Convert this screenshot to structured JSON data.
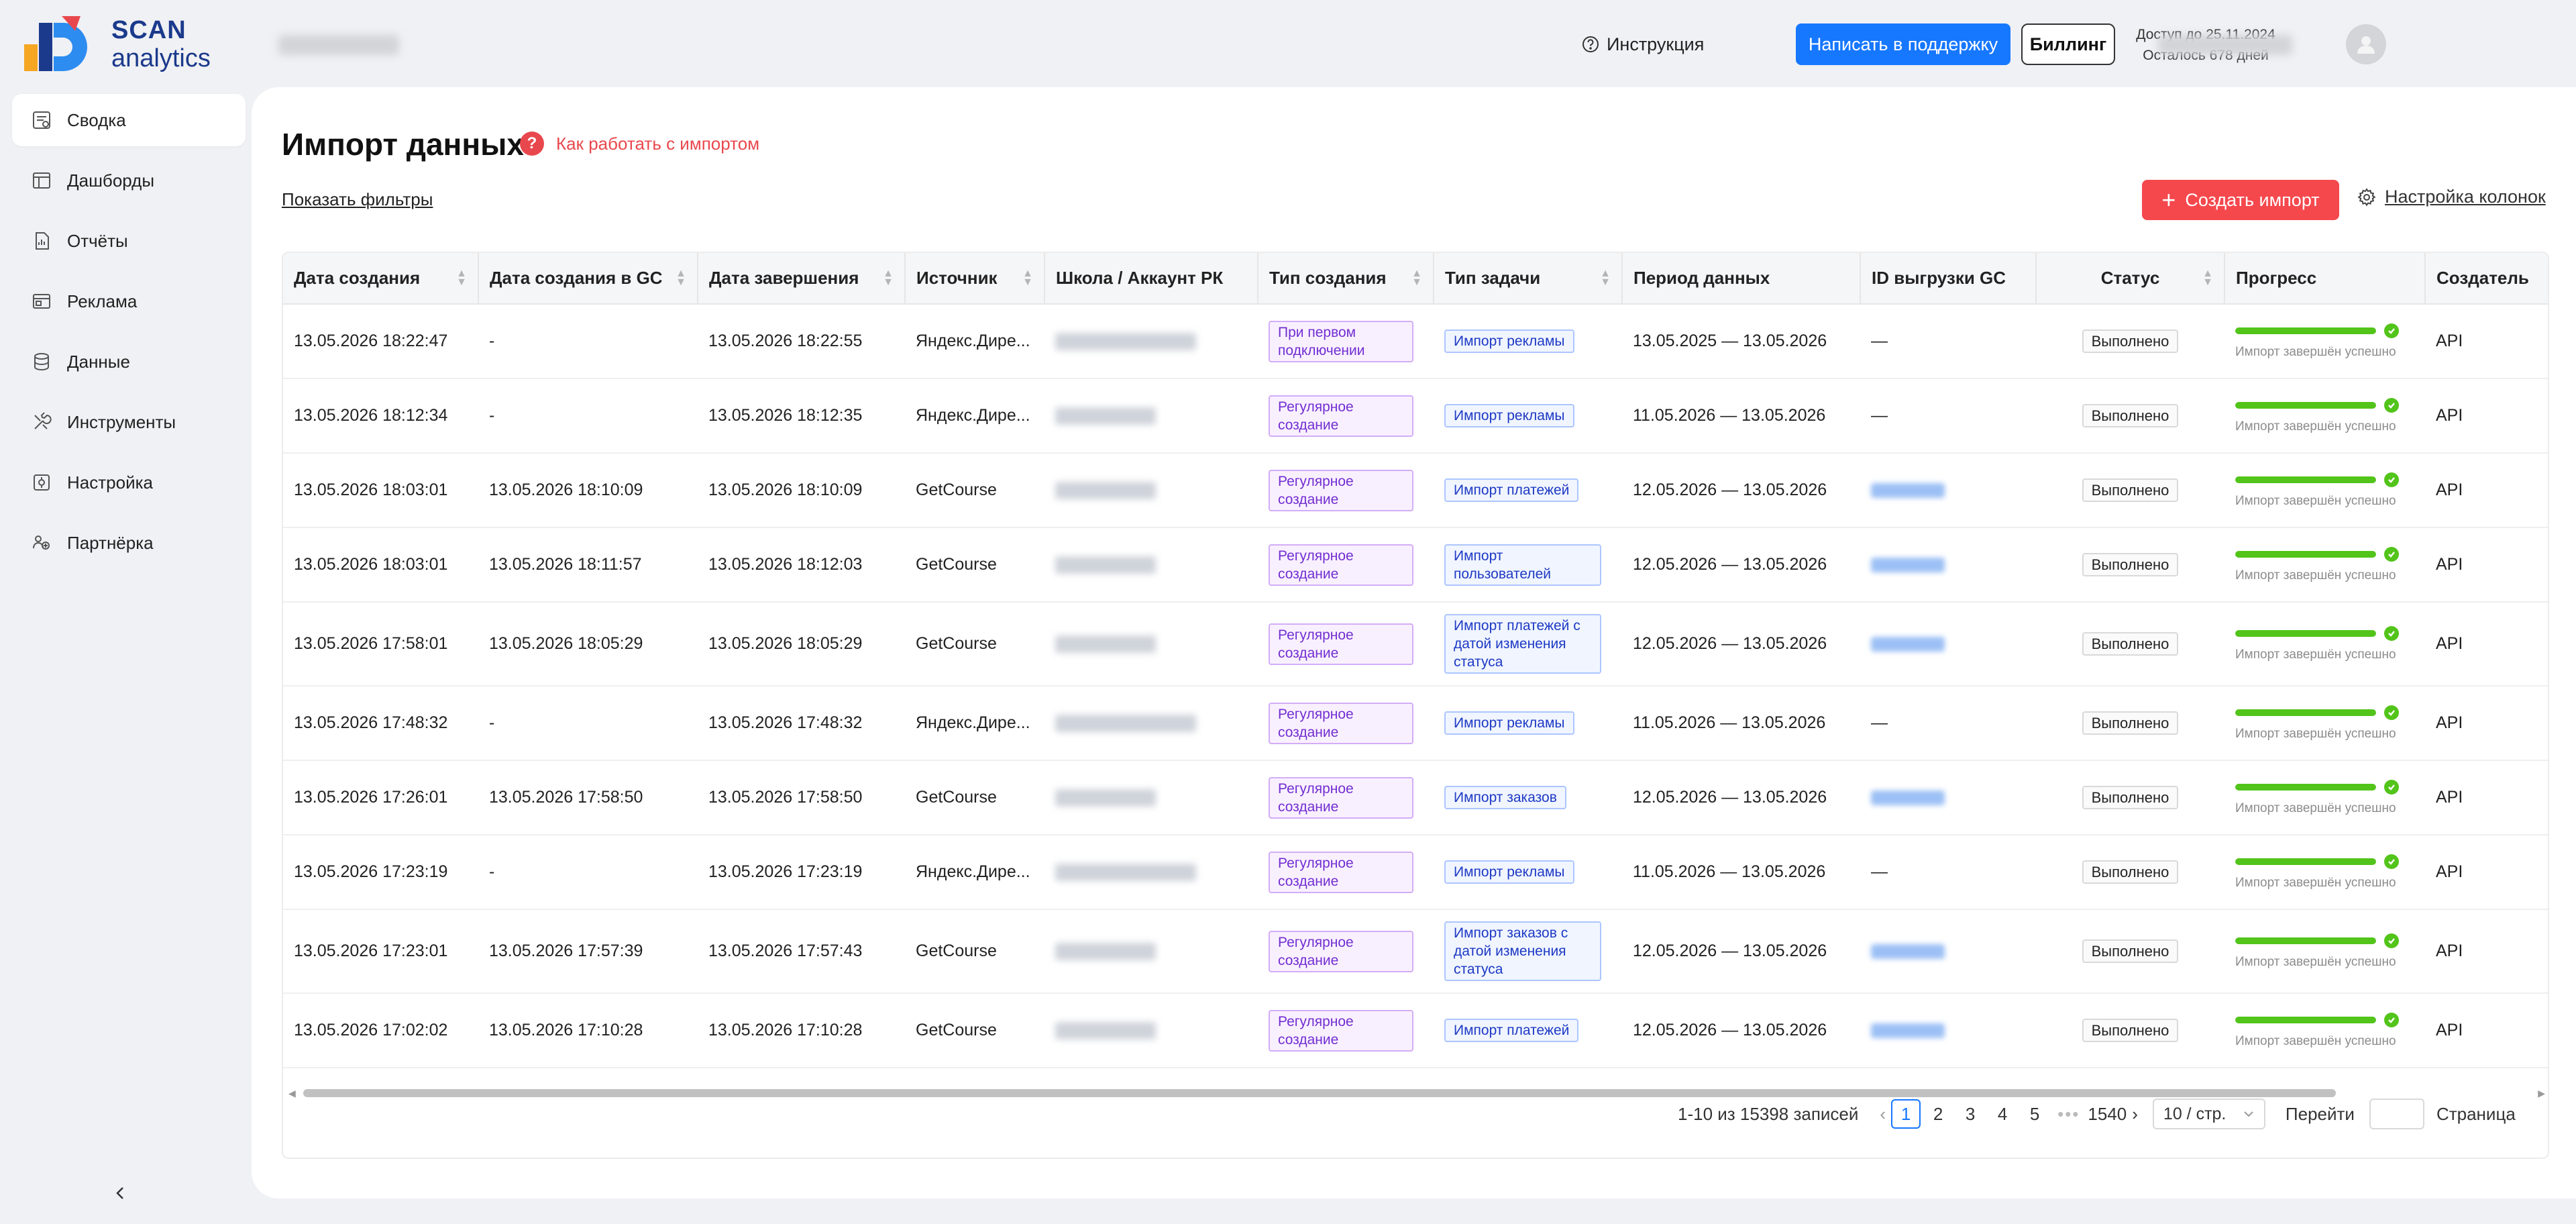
{
  "brand": {
    "line1": "SCAN",
    "line2": "analytics",
    "colors": {
      "blue": "#1b3a8c",
      "orange": "#f5a623",
      "red": "#e8484d",
      "light_blue": "#2d8cf0"
    }
  },
  "sidebar": {
    "items": [
      {
        "label": "Сводка",
        "icon": "summary-icon",
        "active": true
      },
      {
        "label": "Дашборды",
        "icon": "dashboard-icon",
        "active": false
      },
      {
        "label": "Отчёты",
        "icon": "report-icon",
        "active": false
      },
      {
        "label": "Реклама",
        "icon": "ads-icon",
        "active": false
      },
      {
        "label": "Данные",
        "icon": "database-icon",
        "active": false
      },
      {
        "label": "Инструменты",
        "icon": "tools-icon",
        "active": false
      },
      {
        "label": "Настройка",
        "icon": "settings-icon",
        "active": false
      },
      {
        "label": "Партнёрка",
        "icon": "partner-icon",
        "active": false
      }
    ],
    "collapse_icon": "chevron-left-icon"
  },
  "header": {
    "instruction": "Инструкция",
    "support_button": "Написать в поддержку",
    "billing_button": "Биллинг",
    "access_until": "Доступ до 25.11.2024",
    "days_left": "Осталось 678 дней"
  },
  "page": {
    "title": "Импорт данных",
    "help_link": "Как работать с импортом",
    "show_filters": "Показать фильтры",
    "create_button": "Создать импорт",
    "column_settings": "Настройка колонок"
  },
  "table": {
    "columns": [
      {
        "label": "Дата создания",
        "sortable": true
      },
      {
        "label": "Дата создания в GC",
        "sortable": true
      },
      {
        "label": "Дата завершения",
        "sortable": true
      },
      {
        "label": "Источник",
        "sortable": true
      },
      {
        "label": "Школа / Аккаунт РК",
        "sortable": false
      },
      {
        "label": "Тип создания",
        "sortable": true
      },
      {
        "label": "Тип задачи",
        "sortable": true
      },
      {
        "label": "Период данных",
        "sortable": false
      },
      {
        "label": "ID выгрузки GC",
        "sortable": false
      },
      {
        "label": "Статус",
        "sortable": true
      },
      {
        "label": "Прогресс",
        "sortable": false
      },
      {
        "label": "Создатель",
        "sortable": false
      }
    ],
    "rows": [
      {
        "created": "13.05.2026 18:22:47",
        "created_gc": "-",
        "finished": "13.05.2026 18:22:55",
        "source": "Яндекс.Дире...",
        "creation_type": "При первом подключении",
        "task_type": "Импорт рекламы",
        "period": "13.05.2025 — 13.05.2026",
        "gc_id": "—",
        "status": "Выполнено",
        "progress": 1.0,
        "progress_text": "Импорт завершён успешно",
        "creator": "API"
      },
      {
        "created": "13.05.2026 18:12:34",
        "created_gc": "-",
        "finished": "13.05.2026 18:12:35",
        "source": "Яндекс.Дире...",
        "creation_type": "Регулярное создание",
        "task_type": "Импорт рекламы",
        "period": "11.05.2026 — 13.05.2026",
        "gc_id": "—",
        "status": "Выполнено",
        "progress": 1.0,
        "progress_text": "Импорт завершён успешно",
        "creator": "API"
      },
      {
        "created": "13.05.2026 18:03:01",
        "created_gc": "13.05.2026 18:10:09",
        "finished": "13.05.2026 18:10:09",
        "source": "GetCourse",
        "creation_type": "Регулярное создание",
        "task_type": "Импорт платежей",
        "period": "12.05.2026 — 13.05.2026",
        "gc_id": "",
        "status": "Выполнено",
        "progress": 1.0,
        "progress_text": "Импорт завершён успешно",
        "creator": "API"
      },
      {
        "created": "13.05.2026 18:03:01",
        "created_gc": "13.05.2026 18:11:57",
        "finished": "13.05.2026 18:12:03",
        "source": "GetCourse",
        "creation_type": "Регулярное создание",
        "task_type": "Импорт пользователей",
        "period": "12.05.2026 — 13.05.2026",
        "gc_id": "",
        "status": "Выполнено",
        "progress": 1.0,
        "progress_text": "Импорт завершён успешно",
        "creator": "API"
      },
      {
        "created": "13.05.2026 17:58:01",
        "created_gc": "13.05.2026 18:05:29",
        "finished": "13.05.2026 18:05:29",
        "source": "GetCourse",
        "creation_type": "Регулярное создание",
        "task_type": "Импорт платежей с датой изменения статуса",
        "period": "12.05.2026 — 13.05.2026",
        "gc_id": "",
        "status": "Выполнено",
        "progress": 1.0,
        "progress_text": "Импорт завершён успешно",
        "creator": "API"
      },
      {
        "created": "13.05.2026 17:48:32",
        "created_gc": "-",
        "finished": "13.05.2026 17:48:32",
        "source": "Яндекс.Дире...",
        "creation_type": "Регулярное создание",
        "task_type": "Импорт рекламы",
        "period": "11.05.2026 — 13.05.2026",
        "gc_id": "—",
        "status": "Выполнено",
        "progress": 1.0,
        "progress_text": "Импорт завершён успешно",
        "creator": "API"
      },
      {
        "created": "13.05.2026 17:26:01",
        "created_gc": "13.05.2026 17:58:50",
        "finished": "13.05.2026 17:58:50",
        "source": "GetCourse",
        "creation_type": "Регулярное создание",
        "task_type": "Импорт заказов",
        "period": "12.05.2026 — 13.05.2026",
        "gc_id": "",
        "status": "Выполнено",
        "progress": 1.0,
        "progress_text": "Импорт завершён успешно",
        "creator": "API"
      },
      {
        "created": "13.05.2026 17:23:19",
        "created_gc": "-",
        "finished": "13.05.2026 17:23:19",
        "source": "Яндекс.Дире...",
        "creation_type": "Регулярное создание",
        "task_type": "Импорт рекламы",
        "period": "11.05.2026 — 13.05.2026",
        "gc_id": "—",
        "status": "Выполнено",
        "progress": 1.0,
        "progress_text": "Импорт завершён успешно",
        "creator": "API"
      },
      {
        "created": "13.05.2026 17:23:01",
        "created_gc": "13.05.2026 17:57:39",
        "finished": "13.05.2026 17:57:43",
        "source": "GetCourse",
        "creation_type": "Регулярное создание",
        "task_type": "Импорт заказов с датой изменения статуса",
        "period": "12.05.2026 — 13.05.2026",
        "gc_id": "",
        "status": "Выполнено",
        "progress": 1.0,
        "progress_text": "Импорт завершён успешно",
        "creator": "API"
      },
      {
        "created": "13.05.2026 17:02:02",
        "created_gc": "13.05.2026 17:10:28",
        "finished": "13.05.2026 17:10:28",
        "source": "GetCourse",
        "creation_type": "Регулярное создание",
        "task_type": "Импорт платежей",
        "period": "12.05.2026 — 13.05.2026",
        "gc_id": "",
        "status": "Выполнено",
        "progress": 1.0,
        "progress_text": "Импорт завершён успешно",
        "creator": "API"
      }
    ]
  },
  "pagination": {
    "summary": "1-10 из 15398 записей",
    "pages": [
      "1",
      "2",
      "3",
      "4",
      "5"
    ],
    "current": "1",
    "ellipsis": "•••",
    "last": "1540",
    "page_size": "10 / стр.",
    "goto_label": "Перейти",
    "page_label": "Страница"
  },
  "colors": {
    "primary": "#1677ff",
    "danger": "#f5484d",
    "success": "#52c41a"
  }
}
